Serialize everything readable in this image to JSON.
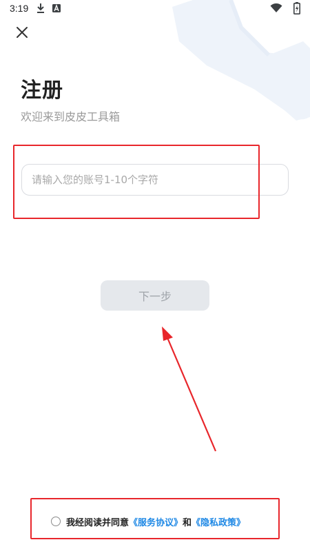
{
  "status_bar": {
    "time": "3:19",
    "icons": [
      "download-icon",
      "app-badge-icon",
      "wifi-icon",
      "battery-charging-icon"
    ]
  },
  "header": {
    "close_icon": "close-icon"
  },
  "main": {
    "title": "注册",
    "subtitle": "欢迎来到皮皮工具箱",
    "account_input": {
      "value": "",
      "placeholder": "请输入您的账号1-10个字符"
    },
    "next_button_label": "下一步"
  },
  "agreement": {
    "checked": false,
    "prefix": "我经阅读并同意",
    "terms_link": "《服务协议》",
    "conjunction": "和",
    "privacy_link": "《隐私政策》"
  },
  "colors": {
    "annotation_red": "#e8262b",
    "link_blue": "#1e88e5",
    "button_disabled_bg": "#e5e8ec",
    "watermark_blue": "#eef3fa"
  }
}
